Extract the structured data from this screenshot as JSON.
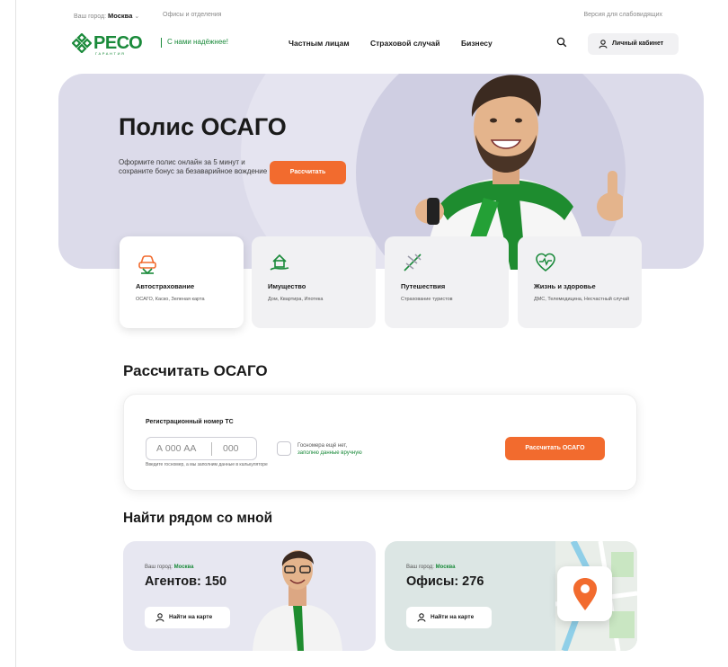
{
  "topbar": {
    "city_label": "Ваш город:",
    "city_value": "Москва",
    "city_chevron": "⌄",
    "offices_link": "Офисы и отделения",
    "accessibility_link": "Версия для слабовидящих"
  },
  "header": {
    "logo_text": "РЕСО",
    "logo_sub": "ГАРАНТИЯ",
    "slogan": "С нами надёжнее!",
    "nav": [
      "Частным лицам",
      "Страховой случай",
      "Бизнесу"
    ],
    "search_icon": "search-icon",
    "cabinet_label": "Личный кабинет"
  },
  "hero": {
    "title": "Полис ОСАГО",
    "subtitle": "Оформите полис онлайн за 5 минут и сохраните бонус за безаварийное вождение",
    "button": "Рассчитать"
  },
  "categories": [
    {
      "title": "Автострахование",
      "desc": "ОСАГО, Каско, Зеленая карта",
      "icon": "car-icon",
      "active": true
    },
    {
      "title": "Имущество",
      "desc": "Дом, Квартира, Ипотека",
      "icon": "house-hand-icon",
      "active": false
    },
    {
      "title": "Путешествия",
      "desc": "Страхование туристов",
      "icon": "plane-icon",
      "active": false
    },
    {
      "title": "Жизнь и здоровье",
      "desc": "ДМС, Телемедицина, Несчастный случай",
      "icon": "heart-pulse-icon",
      "active": false
    }
  ],
  "calc": {
    "heading": "Рассчитать ОСАГО",
    "field_label": "Регистрационный номер ТС",
    "plate_placeholder_main": "А 000 АА",
    "plate_placeholder_region": "000",
    "hint": "Введите госномер, а мы заполним данные в калькуляторе",
    "no_number_text": "Госномера ещё нет,",
    "no_number_link": "заполню данные вручную",
    "button": "Рассчитать ОСАГО"
  },
  "near": {
    "heading": "Найти рядом со мной",
    "agents": {
      "city_label": "Ваш город:",
      "city_value": "Москва",
      "count_text": "Агентов: 150",
      "button": "Найти на карте"
    },
    "offices": {
      "city_label": "Ваш город:",
      "city_value": "Москва",
      "count_text": "Офисы: 276",
      "button": "Найти на карте"
    }
  },
  "colors": {
    "brand_green": "#1a8a3a",
    "accent_orange": "#f26b2e",
    "hero_bg": "#dcdbea"
  }
}
